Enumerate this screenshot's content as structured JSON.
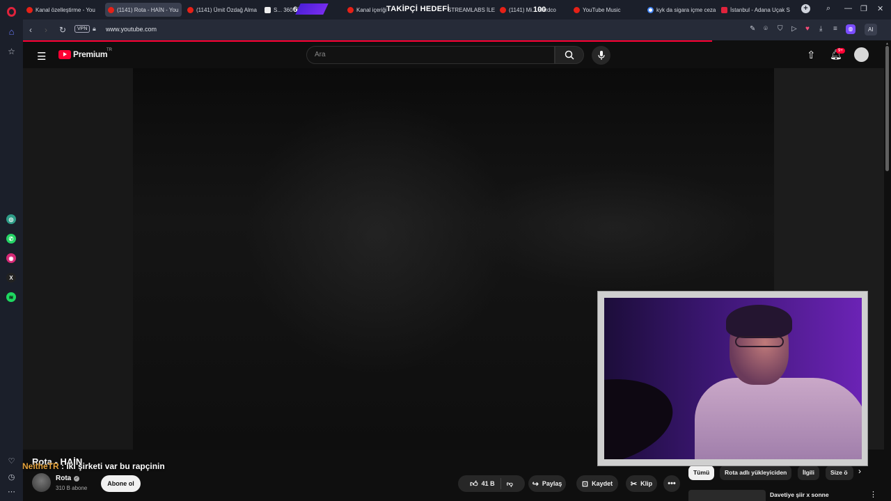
{
  "browser": {
    "tabs": [
      {
        "title": "Kanal özelleştirme - You",
        "favicon": "youtube"
      },
      {
        "title": "(1141) Rota - HAİN - You",
        "favicon": "youtube",
        "active": true
      },
      {
        "title": "(1141) Ümit Özdağ Alma",
        "favicon": "youtube"
      },
      {
        "title": "S... 360° Üst Çek",
        "favicon": "amazon"
      },
      {
        "title": "Kanal içeriği",
        "favicon": "youtube"
      },
      {
        "title": "STREAMLABS İLE",
        "favicon": "youtube"
      },
      {
        "title": "(1141) Mi... Hardco",
        "favicon": "youtube"
      },
      {
        "title": "YouTube Music",
        "favicon": "youtube-music"
      },
      {
        "title": "kyk da sigara içme ceza",
        "favicon": "google"
      },
      {
        "title": "İstanbul - Adana Uçak S",
        "favicon": "obilet"
      }
    ],
    "stream_overlay": {
      "goal_label": "TAKİPÇİ HEDEFİ",
      "current": "6",
      "target": "100"
    },
    "url": "www.youtube.com",
    "vpn_label": "VPN",
    "ai_label": "AI",
    "window_controls": [
      "search-icon",
      "minimize-icon",
      "restore-icon",
      "close-icon"
    ]
  },
  "youtube": {
    "brand": "Premium",
    "region": "TR",
    "search": {
      "placeholder": "Ara"
    },
    "notifications_badge": "9+",
    "video_title": "Rota - HAİN",
    "chat_overlay": {
      "user": "NeitheTR",
      "message": " : iki şirketi var bu rapçinin"
    },
    "channel": {
      "name": "Rota",
      "subscribers": "310 B abone",
      "subscribe_label": "Abone ol"
    },
    "actions": {
      "likes": "41 B",
      "share": "Paylaş",
      "save": "Kaydet",
      "clip": "Klip",
      "more": "•••"
    },
    "chips": [
      "Tümü",
      "Rota adlı yükleyiciden",
      "İlgili",
      "Size ö"
    ],
    "recommendation": {
      "title": "Davetiye şiir x sonne"
    }
  },
  "colors": {
    "youtube_red": "#ff0033",
    "opera_red": "#e0233c",
    "stream_purple": "#6b23b5"
  }
}
